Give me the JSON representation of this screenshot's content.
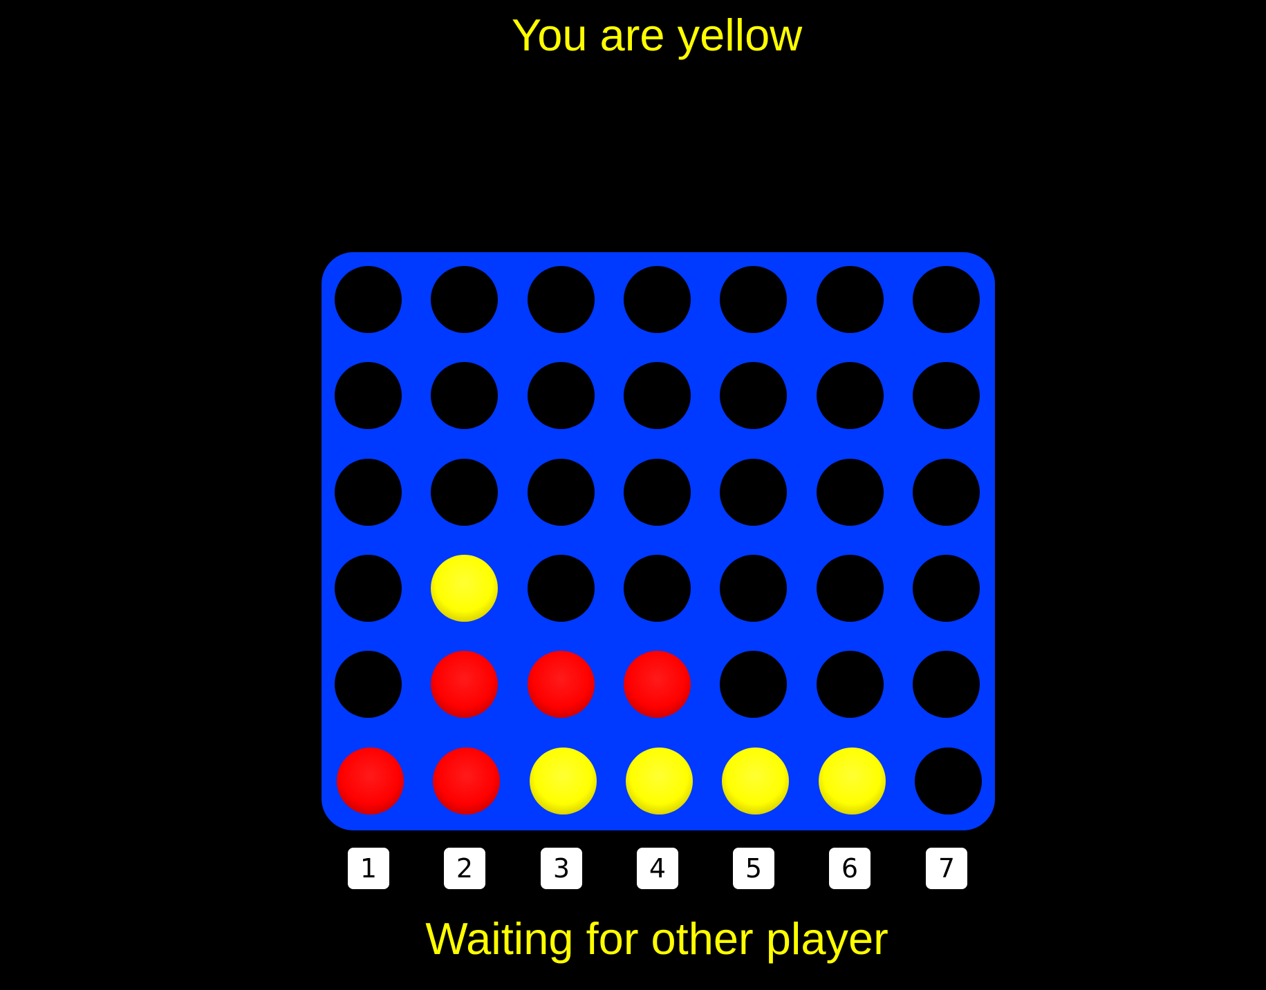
{
  "header": {
    "title": "You are yellow"
  },
  "board": {
    "color": "#0039ff",
    "columns": 7,
    "rows": 6,
    "grid": [
      [
        "empty",
        "empty",
        "empty",
        "empty",
        "empty",
        "empty",
        "empty"
      ],
      [
        "empty",
        "empty",
        "empty",
        "empty",
        "empty",
        "empty",
        "empty"
      ],
      [
        "empty",
        "empty",
        "empty",
        "empty",
        "empty",
        "empty",
        "empty"
      ],
      [
        "empty",
        "yellow",
        "empty",
        "empty",
        "empty",
        "empty",
        "empty"
      ],
      [
        "empty",
        "red",
        "red",
        "red",
        "empty",
        "empty",
        "empty"
      ],
      [
        "red",
        "red",
        "yellow",
        "yellow",
        "yellow",
        "yellow",
        "empty"
      ]
    ]
  },
  "column_buttons": [
    "1",
    "2",
    "3",
    "4",
    "5",
    "6",
    "7"
  ],
  "status": {
    "text": "Waiting for other player"
  },
  "colors": {
    "background": "#000000",
    "text": "#ffff00",
    "red_piece": "#ff0000",
    "yellow_piece": "#ffff00",
    "empty_slot": "#000000"
  }
}
